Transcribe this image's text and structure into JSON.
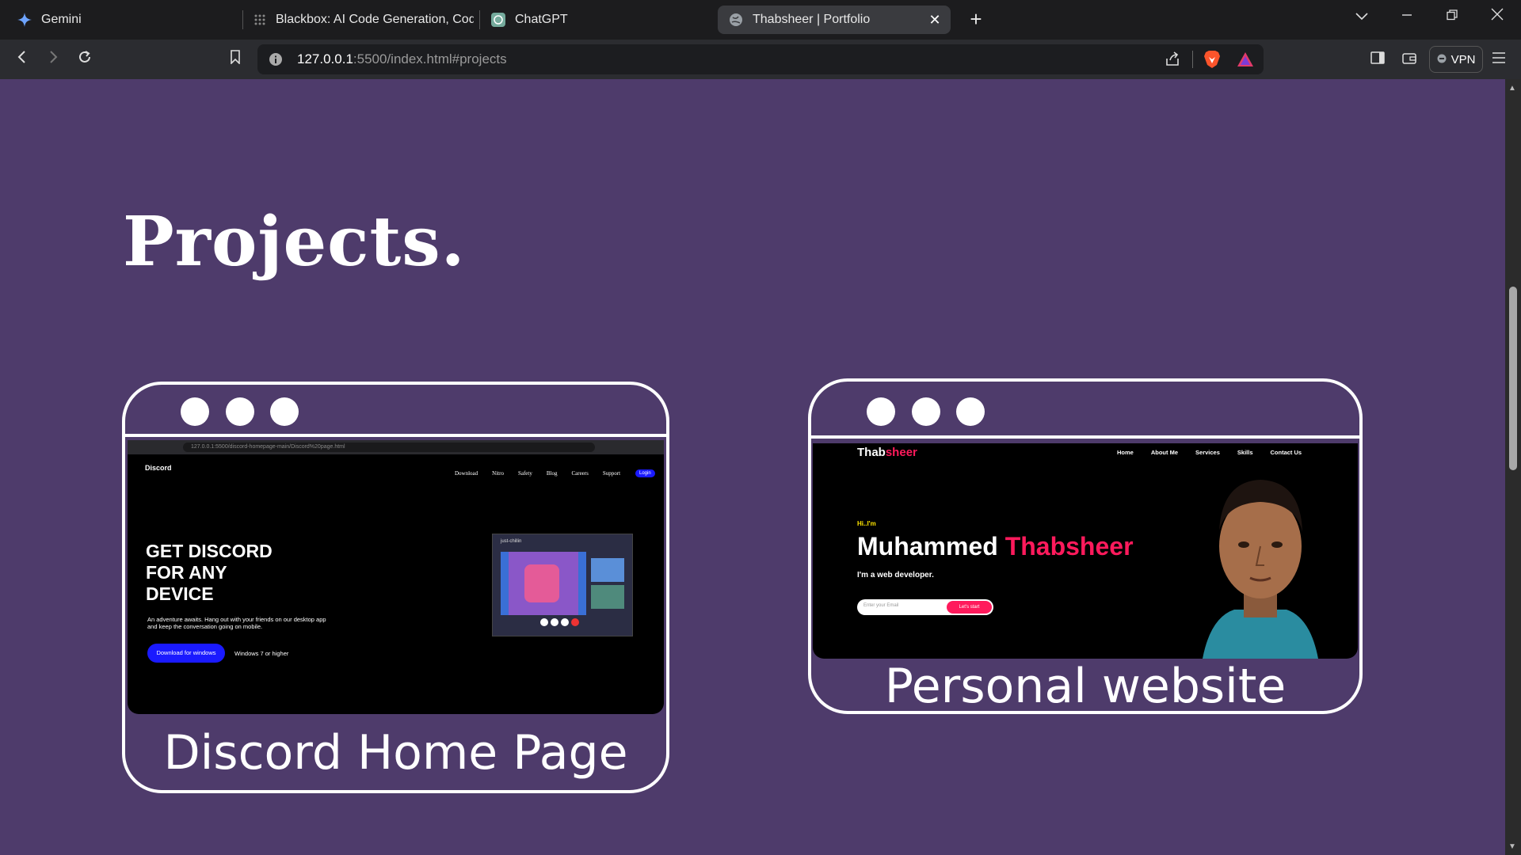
{
  "browser": {
    "tabs": [
      {
        "title": "Gemini",
        "icon": "gemini-icon"
      },
      {
        "title": "Blackbox: AI Code Generation, Code",
        "icon": "blackbox-icon"
      },
      {
        "title": "ChatGPT",
        "icon": "chatgpt-icon"
      },
      {
        "title": "Thabsheer | Portfolio",
        "icon": "globe-icon",
        "active": true
      }
    ],
    "new_tab": "+",
    "url_host": "127.0.0.1",
    "url_rest": ":5500/index.html#projects",
    "vpn_label": "VPN"
  },
  "page": {
    "heading": "Projects.",
    "background": "#4e3b6b",
    "projects": [
      {
        "title": "Discord Home Page",
        "preview": {
          "url": "127.0.0.1:5500/discord-homepage-main/Discord%20page.html",
          "logo": "Discord",
          "nav": [
            "Download",
            "Nitro",
            "Safety",
            "Blog",
            "Careers",
            "Support"
          ],
          "login": "Login",
          "headline_lines": [
            "GET DISCORD",
            "FOR ANY",
            "DEVICE"
          ],
          "body_lines": [
            "An adventure awaits. Hang out with your friends on our desktop app",
            "and keep the conversation going on mobile."
          ],
          "download_button": "Download for windows",
          "requirement": "Windows 7 or higher",
          "app_label": "just-chillin"
        }
      },
      {
        "title": "Personal website",
        "preview": {
          "logo_a": "Thab",
          "logo_b": "sheer",
          "nav": [
            "Home",
            "About Me",
            "Services",
            "Skills",
            "Contact Us"
          ],
          "greeting": "Hi..I'm",
          "name_a": "Muhammed",
          "name_b": "Thabsheer",
          "tagline": "I'm a web developer.",
          "email_placeholder": "Enter your Email",
          "cta": "Let's start"
        }
      }
    ]
  }
}
